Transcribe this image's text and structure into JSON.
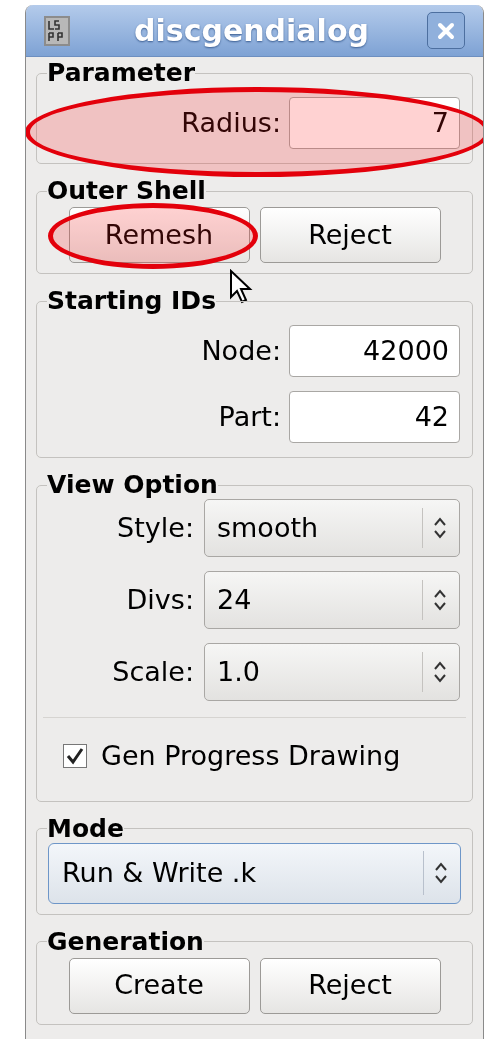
{
  "window": {
    "title": "discgendialog"
  },
  "groups": [
    {
      "title": "Parameter",
      "kind": "fields",
      "rows": [
        {
          "label": "Radius:",
          "value": "7",
          "highlighted": true
        }
      ]
    },
    {
      "title": "Outer Shell",
      "kind": "buttons",
      "buttons": [
        {
          "label": "Remesh",
          "highlighted": true
        },
        {
          "label": "Reject",
          "highlighted": false
        }
      ]
    },
    {
      "title": "Starting IDs",
      "kind": "fields",
      "rows": [
        {
          "label": "Node:",
          "value": "42000",
          "highlighted": false
        },
        {
          "label": "Part:",
          "value": "42",
          "highlighted": false
        }
      ]
    },
    {
      "title": "View Option",
      "kind": "combos",
      "rows": [
        {
          "label": "Style:",
          "value": "smooth"
        },
        {
          "label": "Divs:",
          "value": "24"
        },
        {
          "label": "Scale:",
          "value": "1.0"
        }
      ],
      "checkbox": {
        "label": "Gen Progress Drawing",
        "checked": true
      }
    },
    {
      "title": "Mode",
      "kind": "mode",
      "value": "Run & Write .k"
    },
    {
      "title": "Generation",
      "kind": "buttons",
      "buttons": [
        {
          "label": "Create",
          "highlighted": false
        },
        {
          "label": "Reject",
          "highlighted": false
        }
      ]
    }
  ]
}
